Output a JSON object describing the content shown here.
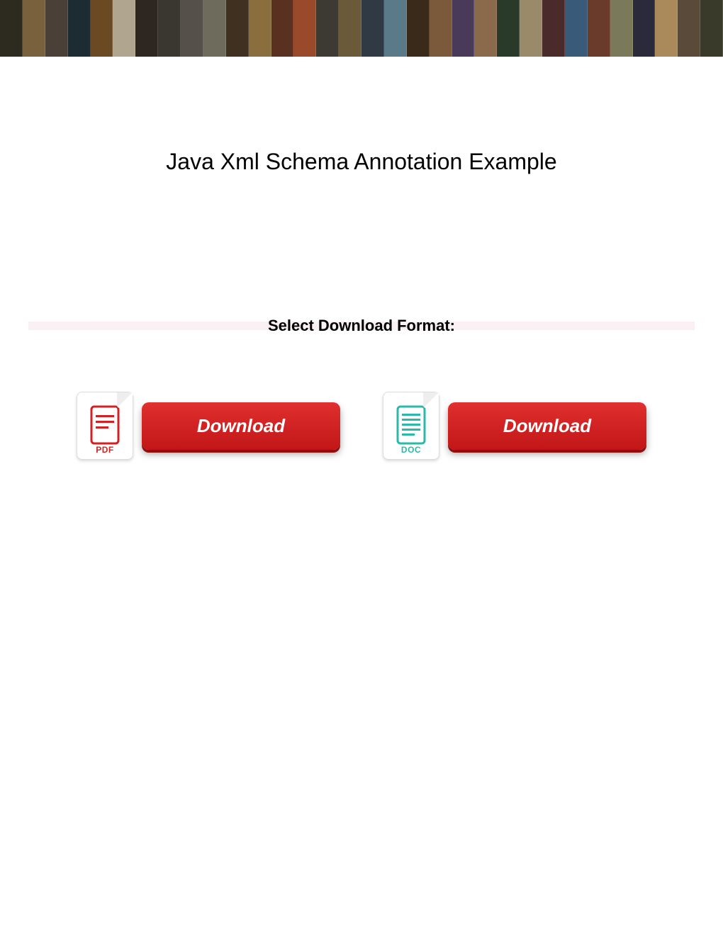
{
  "banner": {
    "tile_colors": [
      "#2d2a1f",
      "#7a613d",
      "#4a4038",
      "#1d2b33",
      "#6b4a23",
      "#b0a690",
      "#2e2620",
      "#3a3730",
      "#555049",
      "#6e6a5c",
      "#403020",
      "#8a6e3d",
      "#5a3020",
      "#9a4a2a",
      "#3d3a33",
      "#6a5a3a",
      "#2f3a45",
      "#5a7a8a",
      "#3a2a1a",
      "#7a5a3a",
      "#4a3a5a",
      "#8a6a4a",
      "#2a3a2a",
      "#9a8a6a",
      "#4a2a2a",
      "#3a5a7a",
      "#6a3a2a",
      "#7a7a5a",
      "#2a2a3a",
      "#aa8a5a",
      "#5a4a3a",
      "#3a3a2a"
    ]
  },
  "main": {
    "title": "Java Xml Schema Annotation Example",
    "select_heading": "Select Download Format:"
  },
  "downloads": [
    {
      "format": "PDF",
      "button_label": "Download",
      "icon_color": "#d32020",
      "type": "pdf"
    },
    {
      "format": "DOC",
      "button_label": "Download",
      "icon_color": "#2bb9a9",
      "type": "doc"
    }
  ]
}
